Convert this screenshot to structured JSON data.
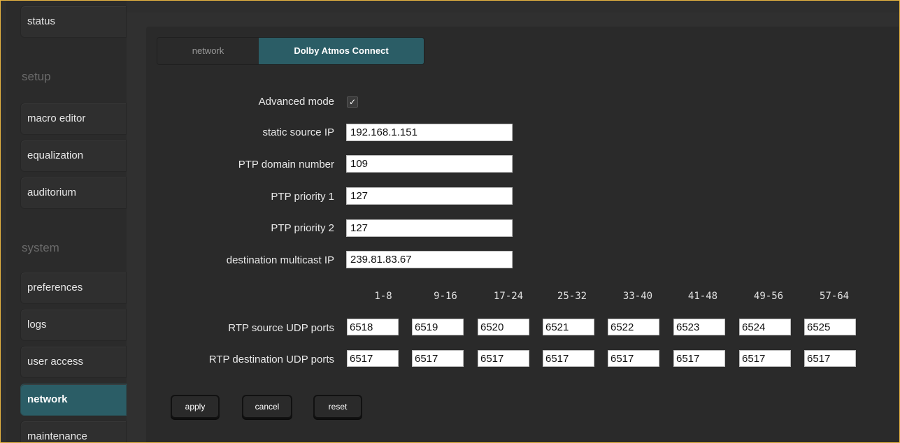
{
  "sidebar": {
    "items": [
      {
        "label": "status"
      },
      {
        "label": "macro editor"
      },
      {
        "label": "equalization"
      },
      {
        "label": "auditorium"
      },
      {
        "label": "preferences"
      },
      {
        "label": "logs"
      },
      {
        "label": "user access"
      },
      {
        "label": "network",
        "active": true
      },
      {
        "label": "maintenance"
      }
    ],
    "sections": {
      "setup": "setup",
      "system": "system"
    }
  },
  "tabs": {
    "network": "network",
    "atmos": "Dolby Atmos Connect"
  },
  "form": {
    "advanced_mode_label": "Advanced mode",
    "advanced_mode_checked": true,
    "static_source_ip_label": "static source IP",
    "static_source_ip": "192.168.1.151",
    "ptp_domain_label": "PTP domain number",
    "ptp_domain": "109",
    "ptp_priority1_label": "PTP priority 1",
    "ptp_priority1": "127",
    "ptp_priority2_label": "PTP priority 2",
    "ptp_priority2": "127",
    "dest_multicast_label": "destination multicast IP",
    "dest_multicast": "239.81.83.67"
  },
  "ports": {
    "columns": [
      "1-8",
      "9-16",
      "17-24",
      "25-32",
      "33-40",
      "41-48",
      "49-56",
      "57-64"
    ],
    "source_label": "RTP source UDP ports",
    "source": [
      "6518",
      "6519",
      "6520",
      "6521",
      "6522",
      "6523",
      "6524",
      "6525"
    ],
    "dest_label": "RTP destination UDP ports",
    "dest": [
      "6517",
      "6517",
      "6517",
      "6517",
      "6517",
      "6517",
      "6517",
      "6517"
    ]
  },
  "buttons": {
    "apply": "apply",
    "cancel": "cancel",
    "reset": "reset"
  },
  "colors": {
    "accent": "#2b5d66",
    "frame_border": "#e7b441"
  }
}
